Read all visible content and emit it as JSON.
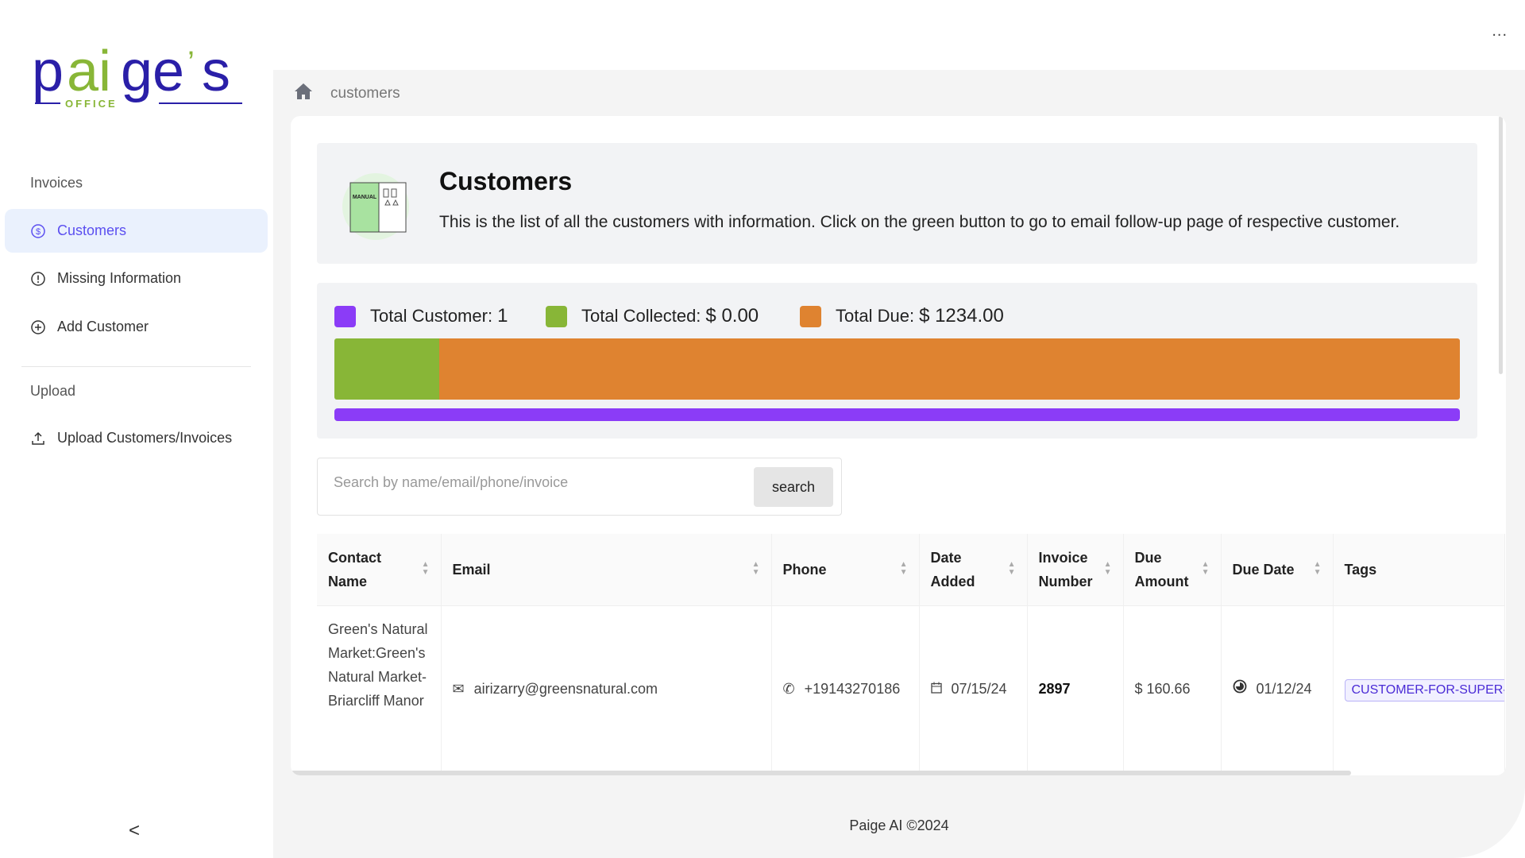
{
  "logo": {
    "text": "paige's",
    "subtitle": "OFFICE"
  },
  "sidebar": {
    "section_invoices": "Invoices",
    "items": [
      {
        "label": "Customers",
        "icon": "dollar-circle-icon",
        "active": true
      },
      {
        "label": "Missing Information",
        "icon": "exclamation-circle-icon"
      },
      {
        "label": "Add Customer",
        "icon": "plus-circle-icon"
      }
    ],
    "section_upload": "Upload",
    "upload_item": {
      "label": "Upload Customers/Invoices",
      "icon": "upload-icon"
    },
    "collapse": "<"
  },
  "topbar": {
    "more": "..."
  },
  "breadcrumb": {
    "current": "customers"
  },
  "header": {
    "title": "Customers",
    "description": "This is the list of all the customers with information. Click on the green button to go to email follow-up page of respective customer."
  },
  "stats": {
    "total_customer_label": "Total Customer:",
    "total_customer": "1",
    "total_collected_label": "Total Collected:",
    "total_collected": "$ 0.00",
    "total_due_label": "Total Due:",
    "total_due": "$ 1234.00",
    "colors": {
      "customer": "#8b3cf7",
      "collected": "#88b637",
      "due": "#df8330"
    },
    "bar_collected_percent": 9.3,
    "bar_due_percent": 90.7
  },
  "search": {
    "placeholder": "Search by name/email/phone/invoice",
    "value": "",
    "button": "search"
  },
  "table": {
    "columns": [
      "Contact Name",
      "Email",
      "Phone",
      "Date Added",
      "Invoice Number",
      "Due Amount",
      "Due Date",
      "Tags"
    ],
    "rows": [
      {
        "name": "Green's Natural Market:Green's Natural Market-Briarcliff Manor",
        "email": "airizarry@greensnatural.com",
        "phone": "+19143270186",
        "date_added": "07/15/24",
        "invoice": "2897",
        "due_amount": "$ 160.66",
        "due_date": "01/12/24",
        "tag": "CUSTOMER-FOR-SUPER-ADMIN"
      }
    ]
  },
  "footer": "Paige AI ©2024"
}
